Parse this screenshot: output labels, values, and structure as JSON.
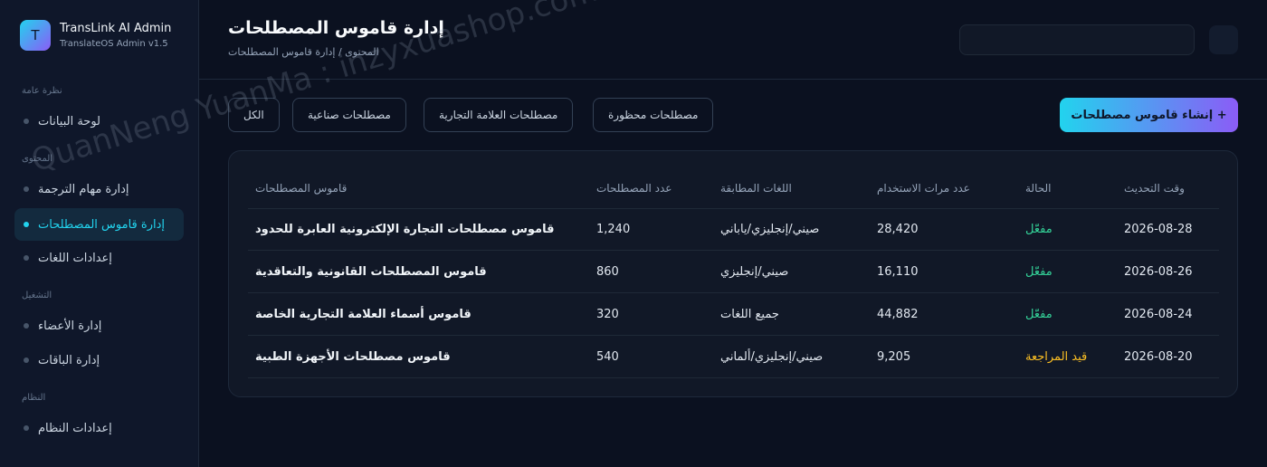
{
  "brand": {
    "logo_letter": "T",
    "title": "TransLink AI Admin",
    "subtitle": "TranslateOS Admin v1.5"
  },
  "sidebar": {
    "sections": [
      {
        "label": "نظرة عامة"
      },
      {
        "label": "المحتوى"
      },
      {
        "label": "التشغيل"
      },
      {
        "label": "النظام"
      }
    ],
    "items": [
      {
        "label": "لوحة البيانات"
      },
      {
        "label": "إدارة مهام الترجمة"
      },
      {
        "label": "إدارة قاموس المصطلحات"
      },
      {
        "label": "إعدادات اللغات"
      },
      {
        "label": "إدارة الأعضاء"
      },
      {
        "label": "إدارة الباقات"
      },
      {
        "label": "إعدادات النظام"
      }
    ],
    "active_item": "إدارة قاموس المصطلحات"
  },
  "header": {
    "title": "إدارة قاموس المصطلحات",
    "breadcrumb": "المحتوى / إدارة قاموس المصطلحات"
  },
  "filters": [
    "الكل",
    "مصطلحات صناعية",
    "مصطلحات العلامة التجارية",
    "مصطلحات محظورة"
  ],
  "create_button": "إنشاء قاموس مصطلحات +",
  "table": {
    "columns": {
      "name": "قاموس المصطلحات",
      "count": "عدد المصطلحات",
      "langs": "اللغات المطابقة",
      "uses": "عدد مرات الاستخدام",
      "status": "الحالة",
      "time": "وقت التحديث"
    },
    "rows": [
      {
        "name": "قاموس مصطلحات التجارة الإلكترونية العابرة للحدود",
        "count": "1,240",
        "langs": "صيني/إنجليزي/ياباني",
        "uses": "28,420",
        "status": "مفعّل",
        "time": "2026-08-28"
      },
      {
        "name": "قاموس المصطلحات القانونية والتعاقدية",
        "count": "860",
        "langs": "صيني/إنجليزي",
        "uses": "16,110",
        "status": "مفعّل",
        "time": "2026-08-26"
      },
      {
        "name": "قاموس أسماء العلامة التجارية الخاصة",
        "count": "320",
        "langs": "جميع اللغات",
        "uses": "44,882",
        "status": "مفعّل",
        "time": "2026-08-24"
      },
      {
        "name": "قاموس مصطلحات الأجهزة الطبية",
        "count": "540",
        "langs": "صيني/إنجليزي/ألماني",
        "uses": "9,205",
        "status": "قيد المراجعة",
        "time": "2026-08-20"
      }
    ]
  },
  "watermark": "QuanNeng YuanMa : inzyxuashop.com",
  "colors": {
    "accent": "#22d3ee",
    "accent_gradient_end": "#8b5cf6",
    "status_active": "#34d399",
    "status_review": "#fbbf24"
  }
}
